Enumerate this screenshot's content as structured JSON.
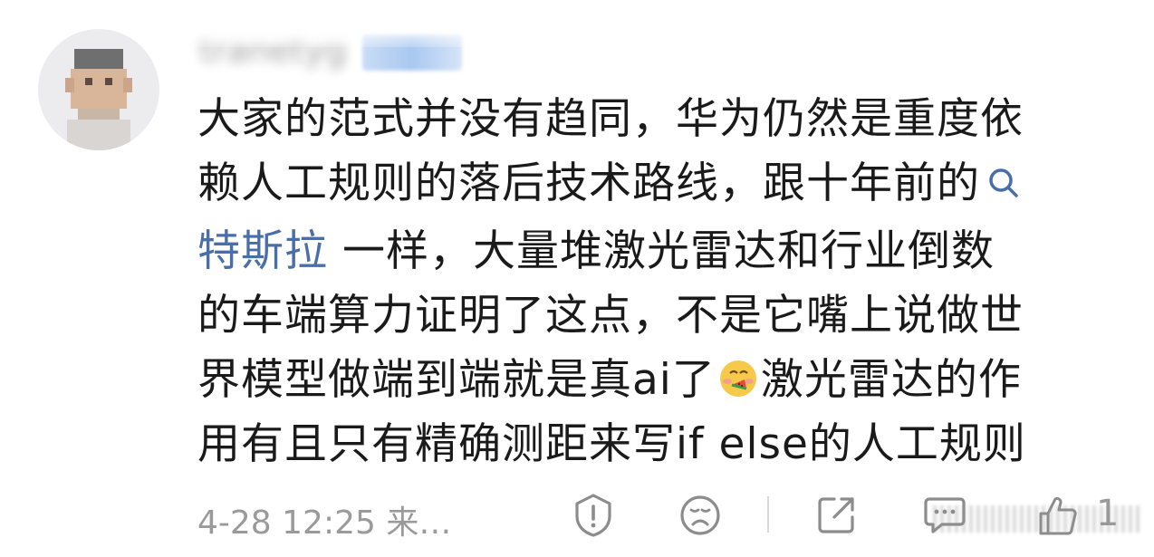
{
  "comment": {
    "username": "tranetyg",
    "lines": [
      "大家的范式并没有趋同，华为仍然是重度依",
      "赖人工规则的落后技术路线，跟十年前的"
    ],
    "topic_link": "特斯拉",
    "line3_rest": " 一样，大量堆激光雷达和行业倒数",
    "line4": "的车端算力证明了这点，不是它嘴上说做世",
    "line5_before_emoji": "界模型做端到端就是真ai了",
    "line5_after_emoji": "激光雷达的作",
    "line6": "用有且只有精确测距来写if else的人工规则",
    "emoji_name": "eating-watermelon-emoji"
  },
  "footer": {
    "timestamp": "4-28 12:25  来…",
    "like_count": "1",
    "icons": [
      "report-icon",
      "dislike-face-icon",
      "share-icon",
      "reply-icon",
      "like-icon"
    ]
  },
  "colors": {
    "text": "#1a1a1a",
    "link": "#4a6ea8",
    "meta": "#9a9a9a",
    "icon": "#8c8c8c"
  }
}
